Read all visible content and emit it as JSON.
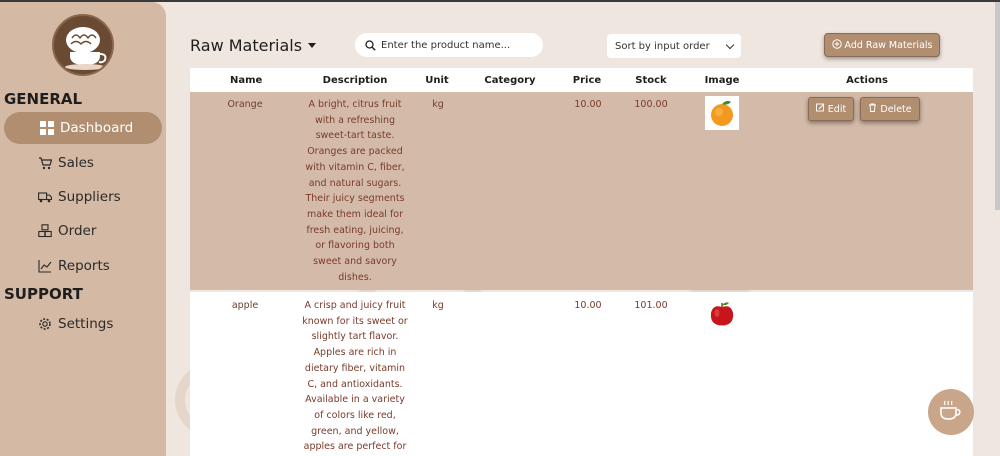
{
  "sidebar": {
    "sections": [
      {
        "title": "GENERAL"
      },
      {
        "title": "SUPPORT"
      }
    ],
    "items": [
      {
        "label": "Dashboard",
        "icon": "grid-icon"
      },
      {
        "label": "Sales",
        "icon": "cart-icon"
      },
      {
        "label": "Suppliers",
        "icon": "truck-icon"
      },
      {
        "label": "Order",
        "icon": "boxes-icon"
      },
      {
        "label": "Reports",
        "icon": "chart-line-icon"
      },
      {
        "label": "Settings",
        "icon": "gear-icon"
      }
    ],
    "active_item": "Dashboard"
  },
  "toolbar": {
    "title": "Raw Materials",
    "search_placeholder": "Enter the product name...",
    "sort_value": "Sort by input order",
    "add_label": "Add Raw Materials"
  },
  "table": {
    "headers": [
      "Name",
      "Description",
      "Unit",
      "Category",
      "Price",
      "Stock",
      "Image",
      "Actions"
    ],
    "rows": [
      {
        "name": "Orange",
        "description_lines": [
          "A bright, citrus fruit",
          "with a refreshing",
          "sweet-tart taste.",
          "Oranges are packed",
          "with vitamin C, fiber,",
          "and natural sugars.",
          "Their juicy segments",
          "make them ideal for",
          "fresh eating, juicing,",
          "or flavoring both",
          "sweet and savory",
          "dishes."
        ],
        "unit": "kg",
        "category": "",
        "price": "10.00",
        "stock": "100.00",
        "image": "orange-fruit"
      },
      {
        "name": "apple",
        "description_lines": [
          "A crisp and juicy fruit",
          "known for its sweet or",
          "slightly tart flavor.",
          "Apples are rich in",
          "dietary fiber, vitamin",
          "C, and antioxidants.",
          "Available in a variety",
          "of colors like red,",
          "green, and yellow,",
          "apples are perfect for"
        ],
        "unit": "kg",
        "category": "",
        "price": "10.00",
        "stock": "101.00",
        "image": "red-apple"
      }
    ],
    "actions": {
      "edit": "Edit",
      "delete": "Delete"
    }
  },
  "colors": {
    "sidebar": "#d4b9a4",
    "accent": "#b28e71",
    "selected_row": "#d4bba9",
    "background": "#efe6df",
    "text_brown": "#7a3b2a"
  }
}
